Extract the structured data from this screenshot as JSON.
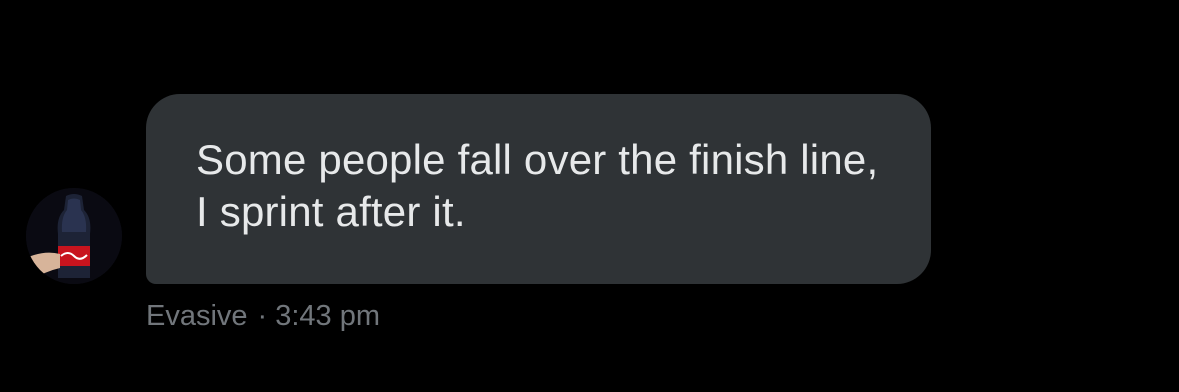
{
  "message": {
    "text": "Some people fall over the finish line, I sprint after it.",
    "sender": "Evasive",
    "separator": "·",
    "time": "3:43 pm"
  },
  "avatar": {
    "icon": "coca-cola-bottle-avatar"
  },
  "colors": {
    "background": "#000000",
    "bubble": "#2f3336",
    "message_text": "#e7e9ea",
    "meta_text": "#71767b"
  }
}
